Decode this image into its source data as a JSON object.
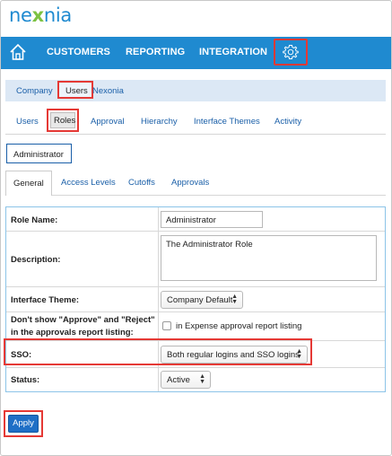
{
  "header": {
    "logo_pre": "ne",
    "logo_x": "x",
    "logo_post": "nia"
  },
  "navbar": {
    "items": [
      "CUSTOMERS",
      "REPORTING",
      "INTEGRATION"
    ],
    "home_icon": "home-icon",
    "settings_icon": "gear-icon",
    "bg_color": "#1f8ad0"
  },
  "subnav": {
    "items": [
      "Company",
      "Users",
      "Nexonia"
    ],
    "selected": "Users"
  },
  "tabs": {
    "items": [
      "Users",
      "Roles",
      "Approval",
      "Hierarchy",
      "Interface Themes",
      "Activity"
    ],
    "selected": "Roles"
  },
  "role_button": "Administrator",
  "detail_tabs": {
    "items": [
      "General",
      "Access Levels",
      "Cutoffs",
      "Approvals"
    ],
    "selected": "General"
  },
  "form": {
    "role_name_label": "Role Name:",
    "role_name_value": "Administrator",
    "description_label": "Description:",
    "description_value": "The Administrator Role",
    "theme_label": "Interface Theme:",
    "theme_value": "Company Default",
    "approve_label_1": "Don't show \"Approve\" and \"Reject\"",
    "approve_label_2": "in the approvals report listing:",
    "approve_checkbox_label": "in Expense approval report listing",
    "approve_checked": false,
    "sso_label": "SSO:",
    "sso_value": "Both regular logins and SSO logins",
    "status_label": "Status:",
    "status_value": "Active"
  },
  "apply_label": "Apply",
  "highlight_color": "#e53935"
}
